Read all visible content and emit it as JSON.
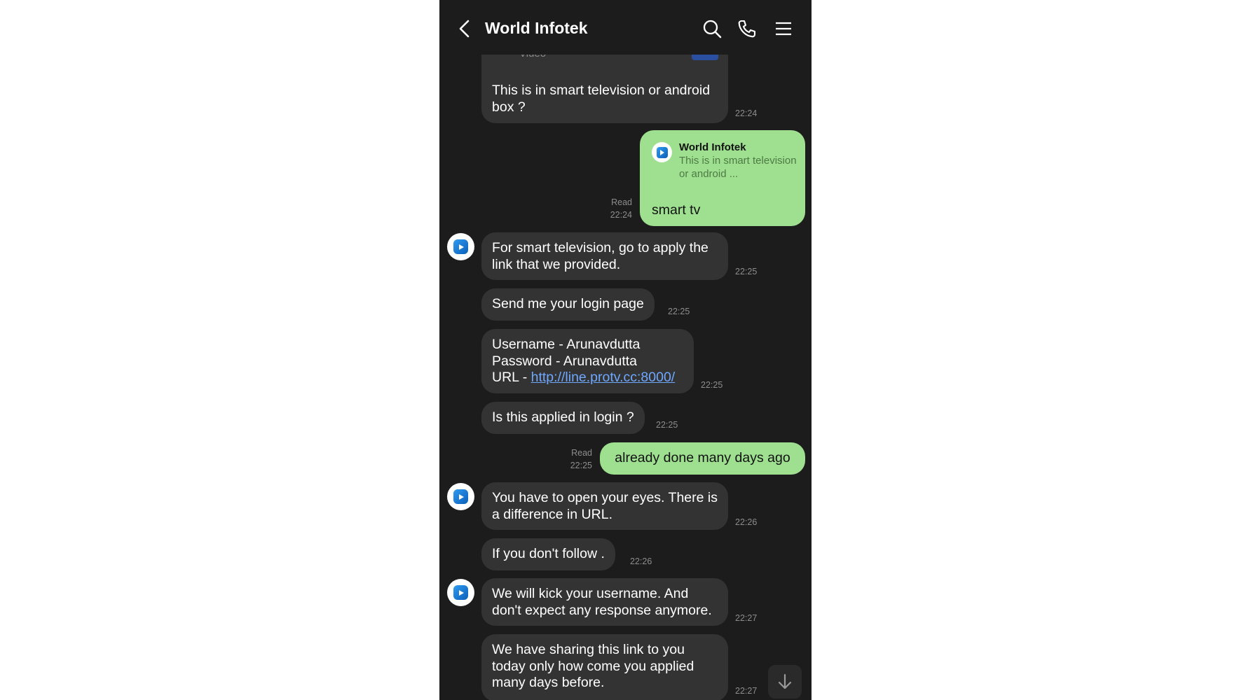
{
  "header": {
    "title": "World Infotek",
    "icons": {
      "back": "back-arrow-icon",
      "search": "search-icon",
      "call": "phone-icon",
      "menu": "menu-icon"
    }
  },
  "colors": {
    "background": "#1c1c1c",
    "incoming_bubble": "#333333",
    "outgoing_bubble": "#9ee08f",
    "link": "#6ea8ff"
  },
  "messages": [
    {
      "id": "m0",
      "direction": "in",
      "caption": "Video",
      "text": "This is in smart television or android box ?",
      "time": "22:24"
    },
    {
      "id": "m1",
      "direction": "out",
      "reply_to": {
        "name": "World Infotek",
        "text": "This is in smart television or android ..."
      },
      "text": "smart tv",
      "status": "Read",
      "time": "22:24"
    },
    {
      "id": "m2",
      "direction": "in",
      "text": "For smart television,  go to apply the link that we provided.",
      "time": "22:25"
    },
    {
      "id": "m3",
      "direction": "in",
      "text": "Send me your login page",
      "time": "22:25"
    },
    {
      "id": "m4",
      "direction": "in",
      "line1": "Username - Arunavdutta",
      "line2": "Password - Arunavdutta",
      "url_label": "URL - ",
      "url": "http://line.protv.cc:8000/",
      "time": "22:25"
    },
    {
      "id": "m5",
      "direction": "in",
      "text": "Is this applied in login ?",
      "time": "22:25"
    },
    {
      "id": "m6",
      "direction": "out",
      "text": "already done many days ago",
      "status": "Read",
      "time": "22:25"
    },
    {
      "id": "m7",
      "direction": "in",
      "text": "You have to open your eyes. There is a difference in URL.",
      "time": "22:26"
    },
    {
      "id": "m8",
      "direction": "in",
      "text": "If you don't follow .",
      "time": "22:26"
    },
    {
      "id": "m9",
      "direction": "in",
      "text": "We will kick your username. And don't expect any response anymore.",
      "time": "22:27"
    },
    {
      "id": "m10",
      "direction": "in",
      "text": "We have sharing this link to you today only how come you applied many days before.",
      "time": "22:27"
    }
  ],
  "scroll_button": {
    "icon": "arrow-down-icon"
  }
}
